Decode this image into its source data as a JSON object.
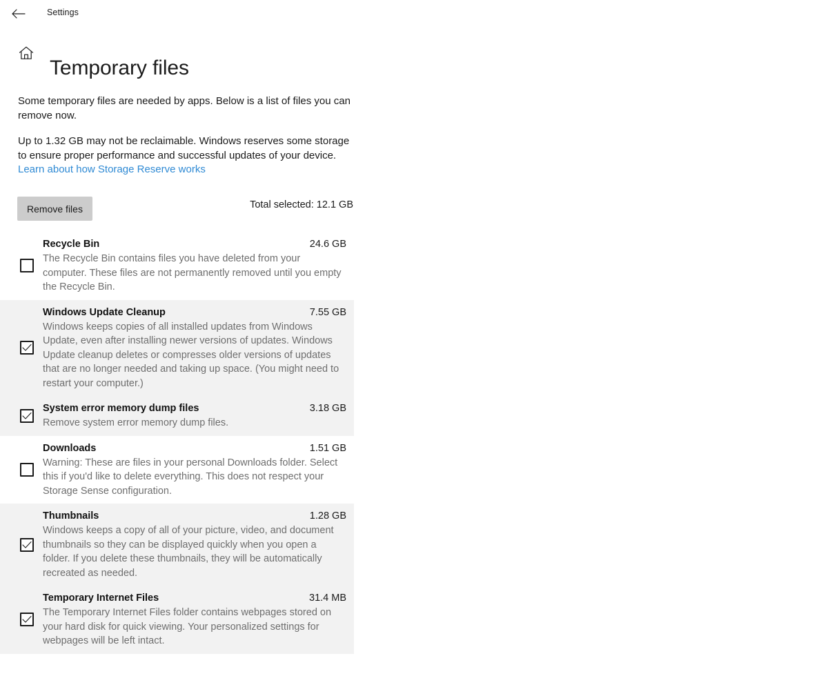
{
  "window": {
    "app_name": "Settings",
    "back_icon": "back-arrow-icon"
  },
  "header": {
    "home_icon": "home-icon",
    "title": "Temporary files"
  },
  "intro": {
    "paragraph_1": "Some temporary files are needed by apps. Below is a list of files you can remove now.",
    "paragraph_2": "Up to 1.32 GB may not be reclaimable. Windows reserves some storage to ensure proper performance and successful updates of your device.",
    "link_label": "Learn about how Storage Reserve works"
  },
  "actions": {
    "remove_button_label": "Remove files",
    "total_selected_label": "Total selected: 12.1 GB"
  },
  "colors": {
    "link": "#2f8ad4",
    "row_shaded_background": "#f2f2f2",
    "button_background": "#cccccc",
    "description_text": "#6e6e6e"
  },
  "files": [
    {
      "title": "Recycle Bin",
      "size": "24.6 GB",
      "description": "The Recycle Bin contains files you have deleted from your computer. These files are not permanently removed until you empty the Recycle Bin.",
      "checked": false,
      "shaded": false
    },
    {
      "title": "Windows Update Cleanup",
      "size": "7.55 GB",
      "description": "Windows keeps copies of all installed updates from Windows Update, even after installing newer versions of updates. Windows Update cleanup deletes or compresses older versions of updates that are no longer needed and taking up space. (You might need to restart your computer.)",
      "checked": true,
      "shaded": true
    },
    {
      "title": "System error memory dump files",
      "size": "3.18 GB",
      "description": "Remove system error memory dump files.",
      "checked": true,
      "shaded": true
    },
    {
      "title": "Downloads",
      "size": "1.51 GB",
      "description": "Warning: These are files in your personal Downloads folder. Select this if you'd like to delete everything. This does not respect your Storage Sense configuration.",
      "checked": false,
      "shaded": false
    },
    {
      "title": "Thumbnails",
      "size": "1.28 GB",
      "description": "Windows keeps a copy of all of your picture, video, and document thumbnails so they can be displayed quickly when you open a folder. If you delete these thumbnails, they will be automatically recreated as needed.",
      "checked": true,
      "shaded": true
    },
    {
      "title": "Temporary Internet Files",
      "size": "31.4 MB",
      "description": "The Temporary Internet Files folder contains webpages stored on your hard disk for quick viewing. Your personalized settings for webpages will be left intact.",
      "checked": true,
      "shaded": true
    }
  ]
}
